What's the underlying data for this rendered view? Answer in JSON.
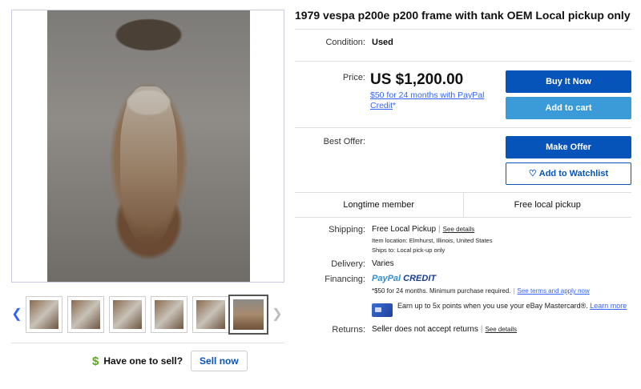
{
  "listing": {
    "title": "1979 vespa p200e p200 frame with tank OEM Local pickup only"
  },
  "gallery": {
    "main_image_alt": "Vespa frame with tank",
    "thumbnails": [
      {
        "label": "thumb-1"
      },
      {
        "label": "thumb-2"
      },
      {
        "label": "thumb-3"
      },
      {
        "label": "thumb-4"
      },
      {
        "label": "thumb-5"
      },
      {
        "label": "thumb-6"
      }
    ],
    "selected_index": 5
  },
  "condition": {
    "label": "Condition:",
    "value": "Used"
  },
  "price": {
    "label": "Price:",
    "value": "US $1,200.00",
    "paypal_credit_text": "$50 for 24 months with PayPal Credit",
    "asterisk": "*"
  },
  "buttons": {
    "buy_now": "Buy It Now",
    "add_to_cart": "Add to cart",
    "make_offer": "Make Offer",
    "add_to_watchlist": "Add to Watchlist"
  },
  "best_offer": {
    "label": "Best Offer:"
  },
  "badges": [
    "Longtime member",
    "Free local pickup"
  ],
  "shipping": {
    "label": "Shipping:",
    "value": "Free Local Pickup",
    "see_details": "See details",
    "item_location": "Item location:  Elmhurst, Illinois, United States",
    "ships_to": "Ships to:  Local pick-up only"
  },
  "delivery": {
    "label": "Delivery:",
    "value": "Varies"
  },
  "financing": {
    "label": "Financing:",
    "paypal_word": "PayPal",
    "credit_word": "CREDIT",
    "terms_text": "*$50 for 24 months. Minimum purchase required.",
    "terms_link": "See terms and apply now",
    "mastercard_text": "Earn up to 5x points when you use your eBay Mastercard®.",
    "learn_more": "Learn more"
  },
  "returns": {
    "label": "Returns:",
    "value": "Seller does not accept returns",
    "see_details": "See details"
  },
  "sell": {
    "dollar_icon": "$",
    "prompt": "Have one to sell?",
    "button": "Sell now"
  },
  "colors": {
    "primary_blue": "#0654ba",
    "light_blue": "#3b9bd8",
    "link_blue": "#3665f3",
    "dollar_green": "#5ba71b"
  }
}
